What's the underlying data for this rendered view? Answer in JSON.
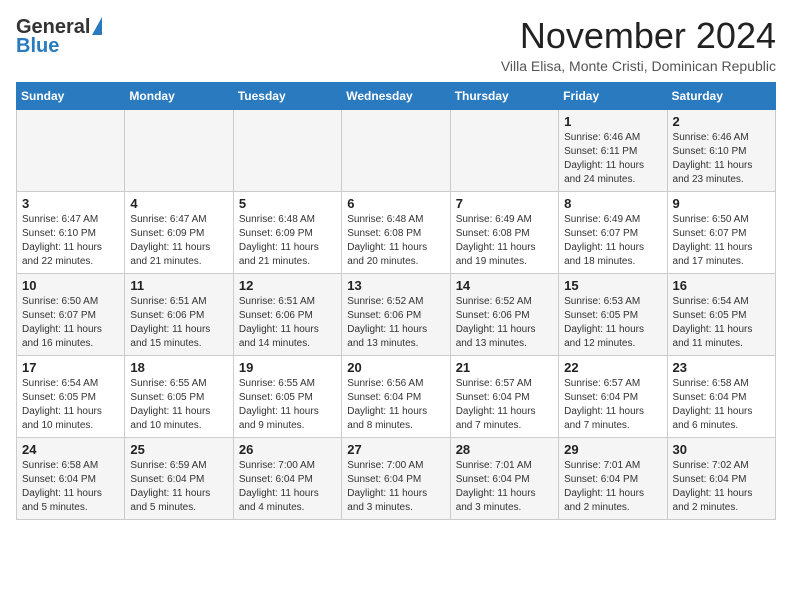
{
  "header": {
    "logo_general": "General",
    "logo_blue": "Blue",
    "month_title": "November 2024",
    "subtitle": "Villa Elisa, Monte Cristi, Dominican Republic"
  },
  "days_of_week": [
    "Sunday",
    "Monday",
    "Tuesday",
    "Wednesday",
    "Thursday",
    "Friday",
    "Saturday"
  ],
  "weeks": [
    [
      {
        "day": "",
        "info": ""
      },
      {
        "day": "",
        "info": ""
      },
      {
        "day": "",
        "info": ""
      },
      {
        "day": "",
        "info": ""
      },
      {
        "day": "",
        "info": ""
      },
      {
        "day": "1",
        "info": "Sunrise: 6:46 AM\nSunset: 6:11 PM\nDaylight: 11 hours\nand 24 minutes."
      },
      {
        "day": "2",
        "info": "Sunrise: 6:46 AM\nSunset: 6:10 PM\nDaylight: 11 hours\nand 23 minutes."
      }
    ],
    [
      {
        "day": "3",
        "info": "Sunrise: 6:47 AM\nSunset: 6:10 PM\nDaylight: 11 hours\nand 22 minutes."
      },
      {
        "day": "4",
        "info": "Sunrise: 6:47 AM\nSunset: 6:09 PM\nDaylight: 11 hours\nand 21 minutes."
      },
      {
        "day": "5",
        "info": "Sunrise: 6:48 AM\nSunset: 6:09 PM\nDaylight: 11 hours\nand 21 minutes."
      },
      {
        "day": "6",
        "info": "Sunrise: 6:48 AM\nSunset: 6:08 PM\nDaylight: 11 hours\nand 20 minutes."
      },
      {
        "day": "7",
        "info": "Sunrise: 6:49 AM\nSunset: 6:08 PM\nDaylight: 11 hours\nand 19 minutes."
      },
      {
        "day": "8",
        "info": "Sunrise: 6:49 AM\nSunset: 6:07 PM\nDaylight: 11 hours\nand 18 minutes."
      },
      {
        "day": "9",
        "info": "Sunrise: 6:50 AM\nSunset: 6:07 PM\nDaylight: 11 hours\nand 17 minutes."
      }
    ],
    [
      {
        "day": "10",
        "info": "Sunrise: 6:50 AM\nSunset: 6:07 PM\nDaylight: 11 hours\nand 16 minutes."
      },
      {
        "day": "11",
        "info": "Sunrise: 6:51 AM\nSunset: 6:06 PM\nDaylight: 11 hours\nand 15 minutes."
      },
      {
        "day": "12",
        "info": "Sunrise: 6:51 AM\nSunset: 6:06 PM\nDaylight: 11 hours\nand 14 minutes."
      },
      {
        "day": "13",
        "info": "Sunrise: 6:52 AM\nSunset: 6:06 PM\nDaylight: 11 hours\nand 13 minutes."
      },
      {
        "day": "14",
        "info": "Sunrise: 6:52 AM\nSunset: 6:06 PM\nDaylight: 11 hours\nand 13 minutes."
      },
      {
        "day": "15",
        "info": "Sunrise: 6:53 AM\nSunset: 6:05 PM\nDaylight: 11 hours\nand 12 minutes."
      },
      {
        "day": "16",
        "info": "Sunrise: 6:54 AM\nSunset: 6:05 PM\nDaylight: 11 hours\nand 11 minutes."
      }
    ],
    [
      {
        "day": "17",
        "info": "Sunrise: 6:54 AM\nSunset: 6:05 PM\nDaylight: 11 hours\nand 10 minutes."
      },
      {
        "day": "18",
        "info": "Sunrise: 6:55 AM\nSunset: 6:05 PM\nDaylight: 11 hours\nand 10 minutes."
      },
      {
        "day": "19",
        "info": "Sunrise: 6:55 AM\nSunset: 6:05 PM\nDaylight: 11 hours\nand 9 minutes."
      },
      {
        "day": "20",
        "info": "Sunrise: 6:56 AM\nSunset: 6:04 PM\nDaylight: 11 hours\nand 8 minutes."
      },
      {
        "day": "21",
        "info": "Sunrise: 6:57 AM\nSunset: 6:04 PM\nDaylight: 11 hours\nand 7 minutes."
      },
      {
        "day": "22",
        "info": "Sunrise: 6:57 AM\nSunset: 6:04 PM\nDaylight: 11 hours\nand 7 minutes."
      },
      {
        "day": "23",
        "info": "Sunrise: 6:58 AM\nSunset: 6:04 PM\nDaylight: 11 hours\nand 6 minutes."
      }
    ],
    [
      {
        "day": "24",
        "info": "Sunrise: 6:58 AM\nSunset: 6:04 PM\nDaylight: 11 hours\nand 5 minutes."
      },
      {
        "day": "25",
        "info": "Sunrise: 6:59 AM\nSunset: 6:04 PM\nDaylight: 11 hours\nand 5 minutes."
      },
      {
        "day": "26",
        "info": "Sunrise: 7:00 AM\nSunset: 6:04 PM\nDaylight: 11 hours\nand 4 minutes."
      },
      {
        "day": "27",
        "info": "Sunrise: 7:00 AM\nSunset: 6:04 PM\nDaylight: 11 hours\nand 3 minutes."
      },
      {
        "day": "28",
        "info": "Sunrise: 7:01 AM\nSunset: 6:04 PM\nDaylight: 11 hours\nand 3 minutes."
      },
      {
        "day": "29",
        "info": "Sunrise: 7:01 AM\nSunset: 6:04 PM\nDaylight: 11 hours\nand 2 minutes."
      },
      {
        "day": "30",
        "info": "Sunrise: 7:02 AM\nSunset: 6:04 PM\nDaylight: 11 hours\nand 2 minutes."
      }
    ]
  ]
}
